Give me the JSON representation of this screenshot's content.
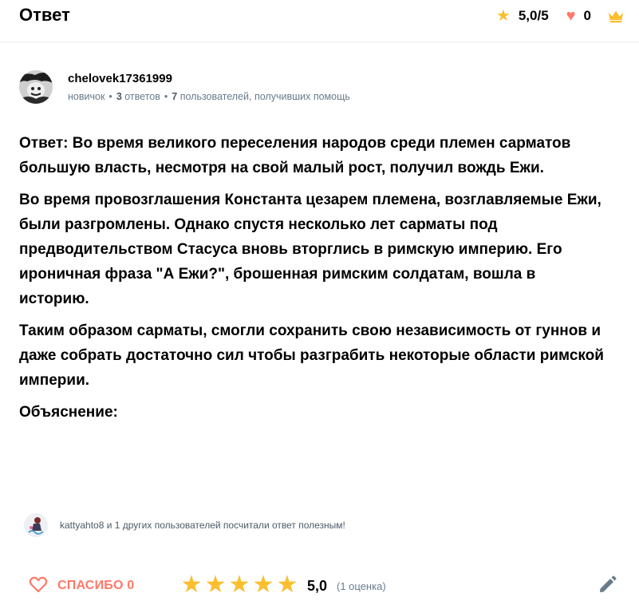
{
  "header": {
    "title": "Ответ",
    "rating": "5,0/5",
    "rating_icon": "star-icon",
    "likes": "0",
    "likes_icon": "heart-icon",
    "crown_icon": "crown-icon",
    "accent_gold": "#fbbe2e",
    "accent_red": "#ff7968"
  },
  "author": {
    "name": "chelovek17361999",
    "rank": "новичок",
    "answers_count": "3",
    "answers_label": "ответов",
    "helped_count": "7",
    "helped_label": "пользователей, получивших помощь"
  },
  "answer": {
    "paragraphs": [
      "Ответ: Во время великого переселения народов среди племен сарматов большую власть, несмотря на свой малый рост, получил вождь Ежи.",
      "Во время провозглашения Константа цезарем племена, возглавляемые Ежи, были разгромлены. Однако спустя несколько лет сарматы под предводительством Стасуса вновь вторглись в римскую империю. Его ироничная фраза \"А Ежи?\", брошенная римским солдатам, вошла в историю.",
      "Таким образом сарматы, смогли сохранить свою независимость от гуннов и даже собрать достаточно сил чтобы разграбить некоторые области римской империи.",
      "Объяснение:"
    ]
  },
  "helpful": {
    "text": "kattyahto8 и 1 других пользователей посчитали ответ полезным!"
  },
  "footer": {
    "thanks_label": "СПАСИБО 0",
    "stars_filled": 5,
    "stars_total": 5,
    "rating_value": "5,0",
    "rating_count": "(1 оценка)",
    "edit_icon": "pencil-icon"
  }
}
